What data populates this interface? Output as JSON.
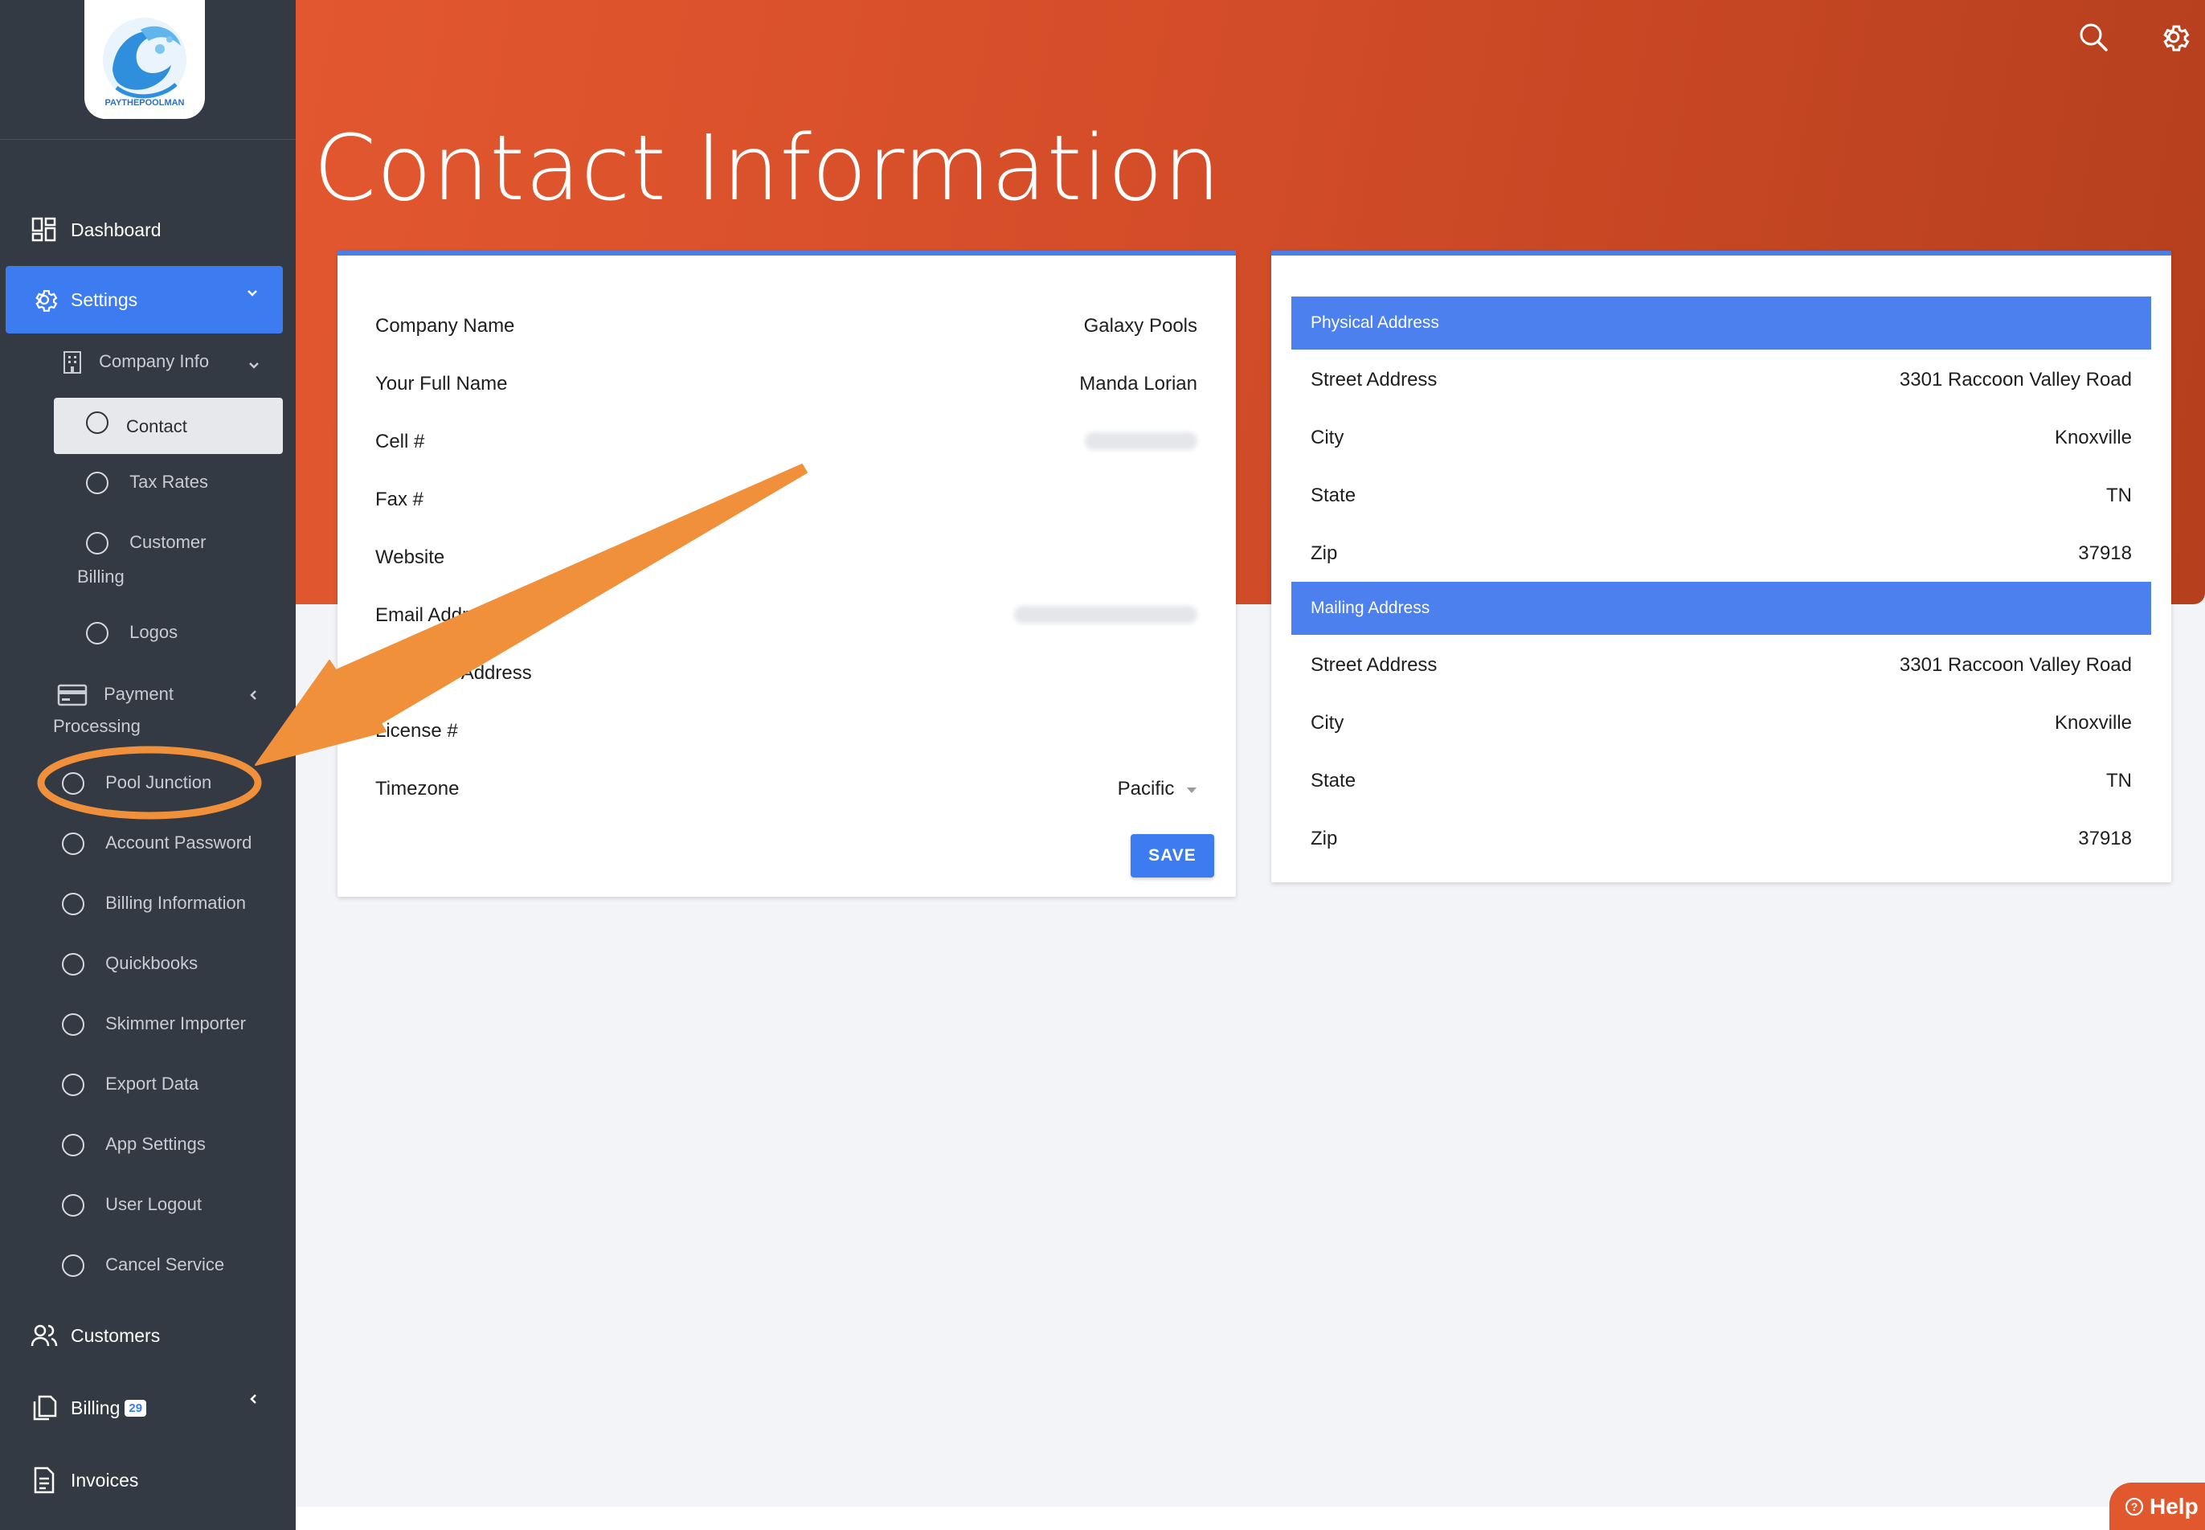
{
  "sidebar": {
    "logo_text": "PAYTHEPOOLMAN",
    "dashboard": "Dashboard",
    "settings": "Settings",
    "company_info": "Company Info",
    "contact": "Contact",
    "tax_rates": "Tax Rates",
    "customer_billing_1": "Customer",
    "customer_billing_2": "Billing",
    "logos": "Logos",
    "payment_processing_1": "Payment",
    "payment_processing_2": "Processing",
    "pool_junction": "Pool Junction",
    "account_password": "Account Password",
    "billing_information": "Billing Information",
    "quickbooks": "Quickbooks",
    "skimmer_importer": "Skimmer Importer",
    "export_data": "Export Data",
    "app_settings": "App Settings",
    "user_logout": "User Logout",
    "cancel_service": "Cancel Service",
    "customers": "Customers",
    "billing": "Billing",
    "billing_badge": "29",
    "invoices": "Invoices"
  },
  "header": {
    "title": "Contact Information"
  },
  "contact_card": {
    "company_name_label": "Company Name",
    "company_name_value": "Galaxy Pools",
    "full_name_label": "Your Full Name",
    "full_name_value": "Manda Lorian",
    "cell_label": "Cell #",
    "fax_label": "Fax #",
    "website_label": "Website",
    "email_label": "Email Address",
    "cc_email_label": "CC Email Address",
    "license_label": "License #",
    "timezone_label": "Timezone",
    "timezone_value": "Pacific",
    "save_label": "SAVE"
  },
  "address_card": {
    "physical_header": "Physical Address",
    "mailing_header": "Mailing Address",
    "physical": {
      "street_label": "Street Address",
      "street_value": "3301 Raccoon Valley Road",
      "city_label": "City",
      "city_value": "Knoxville",
      "state_label": "State",
      "state_value": "TN",
      "zip_label": "Zip",
      "zip_value": "37918"
    },
    "mailing": {
      "street_label": "Street Address",
      "street_value": "3301 Raccoon Valley Road",
      "city_label": "City",
      "city_value": "Knoxville",
      "state_label": "State",
      "state_value": "TN",
      "zip_label": "Zip",
      "zip_value": "37918"
    }
  },
  "help": {
    "label": "Help"
  },
  "colors": {
    "sidebar_bg": "#333a44",
    "accent_blue": "#3d7bf1",
    "header_orange": "#d44d28",
    "annotation_orange": "#f0903a"
  }
}
